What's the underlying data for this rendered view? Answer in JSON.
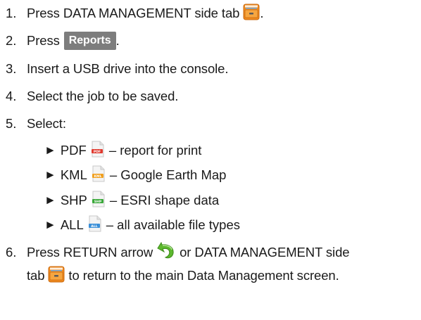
{
  "steps": [
    {
      "num": "1.",
      "pre": "Press DATA MANAGEMENT side tab",
      "post": "."
    },
    {
      "num": "2.",
      "pre": "Press",
      "button": "Reports",
      "post": "."
    },
    {
      "num": "3.",
      "text": "Insert a USB drive into the console."
    },
    {
      "num": "4.",
      "text": "Select the job to be saved."
    },
    {
      "num": "5.",
      "text": "Select:"
    }
  ],
  "options": [
    {
      "bullet": "►",
      "label": "PDF",
      "icon": "pdf-file-icon",
      "badge": "PDF",
      "color": "#e03a2f",
      "desc": "– report for print"
    },
    {
      "bullet": "►",
      "label": "KML",
      "icon": "kml-file-icon",
      "badge": "KML",
      "color": "#f0a020",
      "desc": "– Google Earth Map"
    },
    {
      "bullet": "►",
      "label": "SHP",
      "icon": "shp-file-icon",
      "badge": "SHP",
      "color": "#3aa83a",
      "desc": "– ESRI shape data"
    },
    {
      "bullet": "►",
      "label": "ALL",
      "icon": "all-file-icon",
      "badge": "ALL",
      "color": "#3a8fd8",
      "desc": "– all available file types"
    }
  ],
  "step6": {
    "num": "6.",
    "line1_pre": "Press RETURN arrow",
    "line1_post": "or DATA MANAGEMENT side",
    "line2_pre": "tab",
    "line2_post": "to return to the main Data Management screen."
  },
  "icons": {
    "data_management": "file-cabinet-icon",
    "return": "return-arrow-icon"
  },
  "colors": {
    "reports_button_bg": "#7d7d7d",
    "cabinet_orange": "#f08a1e",
    "return_green": "#5cb82e"
  }
}
